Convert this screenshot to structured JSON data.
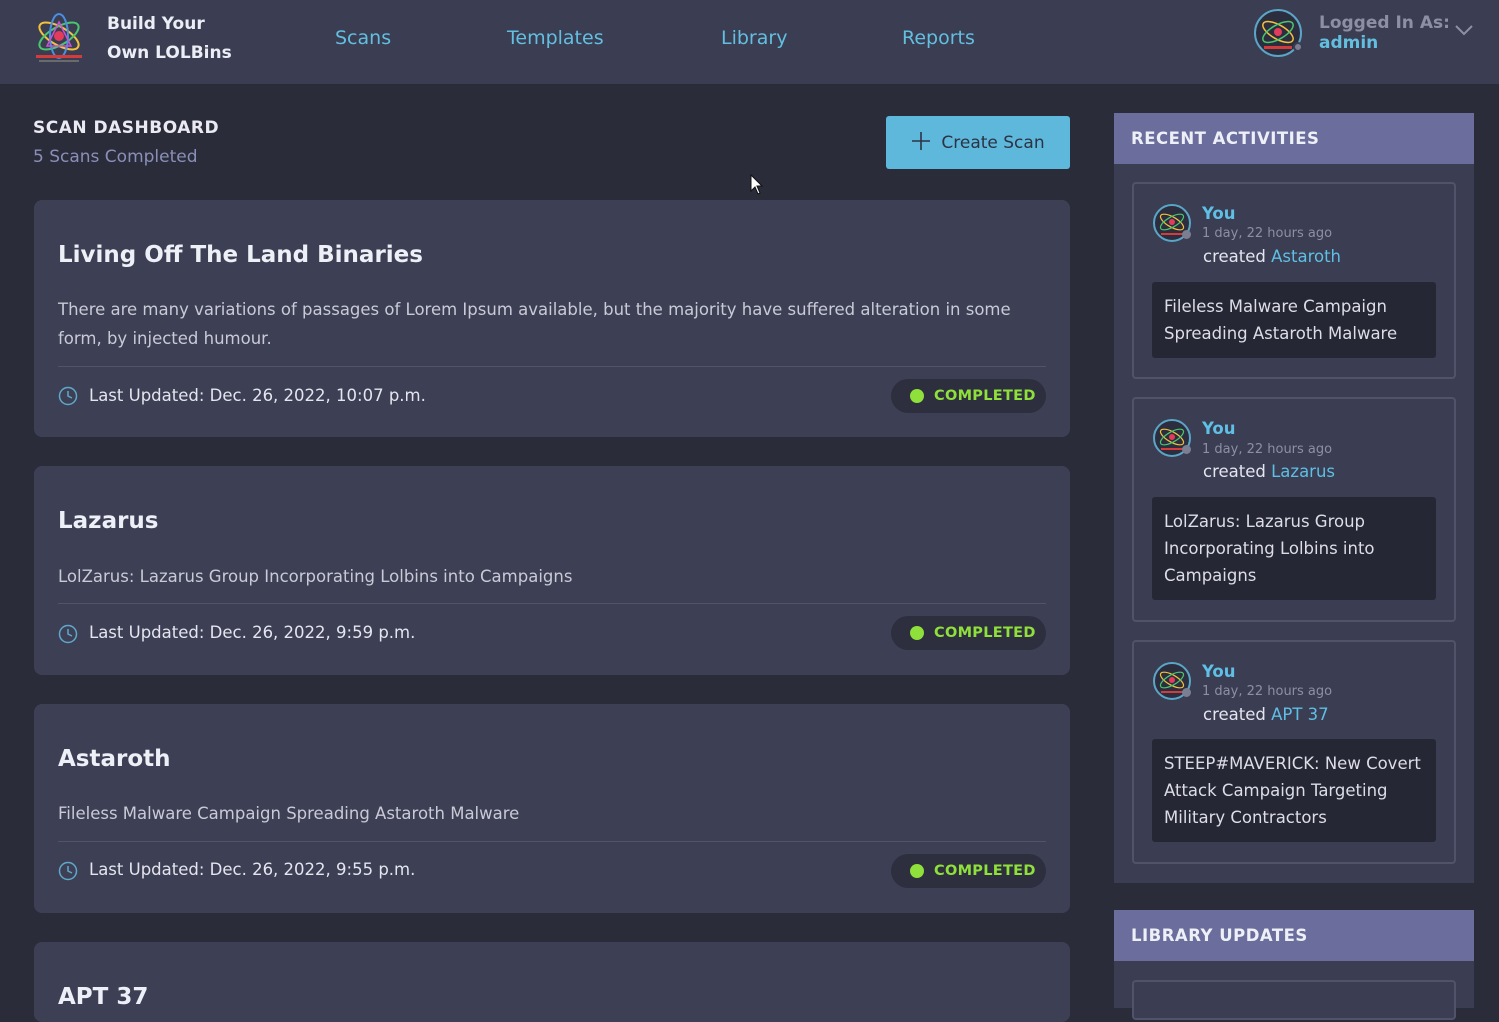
{
  "brand": {
    "line1": "Build Your",
    "line2": "Own LOLBins"
  },
  "nav": [
    {
      "label": "Scans"
    },
    {
      "label": "Templates"
    },
    {
      "label": "Library"
    },
    {
      "label": "Reports"
    }
  ],
  "user": {
    "logged_in_label": "Logged In As:",
    "username": "admin"
  },
  "dashboard": {
    "title": "SCAN DASHBOARD",
    "subtitle": "5 Scans Completed",
    "create_button": "Create Scan"
  },
  "scans": [
    {
      "title": "Living Off The Land Binaries",
      "description": "There are many variations of passages of Lorem Ipsum available, but the majority have suffered alteration in some form, by injected humour.",
      "updated": "Last Updated: Dec. 26, 2022, 10:07 p.m.",
      "status": "COMPLETED"
    },
    {
      "title": "Lazarus",
      "description": "LolZarus: Lazarus Group Incorporating Lolbins into Campaigns",
      "updated": "Last Updated: Dec. 26, 2022, 9:59 p.m.",
      "status": "COMPLETED"
    },
    {
      "title": "Astaroth",
      "description": "Fileless Malware Campaign Spreading Astaroth Malware",
      "updated": "Last Updated: Dec. 26, 2022, 9:55 p.m.",
      "status": "COMPLETED"
    },
    {
      "title": "APT 37"
    }
  ],
  "recent_activities": {
    "title": "RECENT ACTIVITIES",
    "items": [
      {
        "user": "You",
        "time": "1 day, 22 hours ago",
        "action": "created",
        "target": "Astaroth",
        "summary": "Fileless Malware Campaign Spreading Astaroth Malware"
      },
      {
        "user": "You",
        "time": "1 day, 22 hours ago",
        "action": "created",
        "target": "Lazarus",
        "summary": "LolZarus: Lazarus Group Incorporating Lolbins into Campaigns"
      },
      {
        "user": "You",
        "time": "1 day, 22 hours ago",
        "action": "created",
        "target": "APT 37",
        "summary": "STEEP#MAVERICK: New Covert Attack Campaign Targeting Military Contractors"
      }
    ]
  },
  "library_updates": {
    "title": "LIBRARY UPDATES"
  },
  "colors": {
    "background": "#2b2c3a",
    "card": "#3d3f55",
    "accent": "#5db8dc",
    "panel_header": "#6b6d9c",
    "status_green": "#8fe03a"
  },
  "icons": [
    "atom-logo-icon",
    "clock-icon",
    "plus-icon",
    "chevron-down-icon",
    "avatar-icon",
    "mouse-cursor-icon"
  ]
}
